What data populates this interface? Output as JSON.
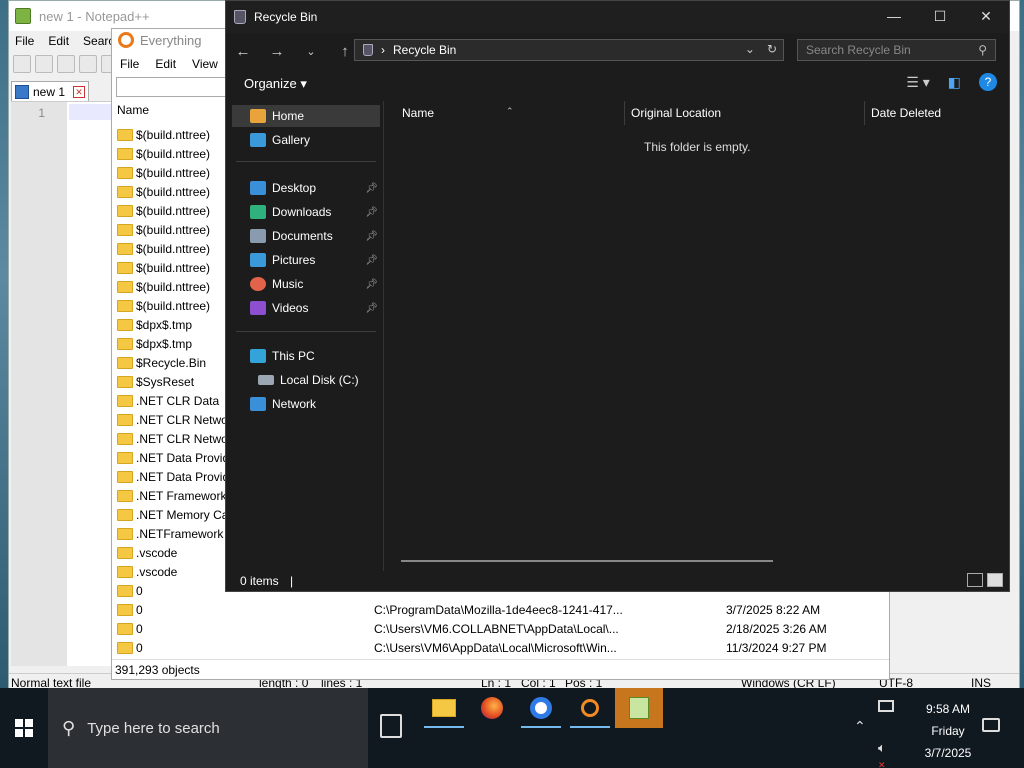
{
  "notepadpp": {
    "title": "new 1 - Notepad++",
    "menu": [
      "File",
      "Edit",
      "Search"
    ],
    "tab_label": "new 1",
    "line_number": "1",
    "status": {
      "type": "Normal text file",
      "length": "length : 0",
      "lines": "lines : 1",
      "ln": "Ln : 1",
      "col": "Col : 1",
      "pos": "Pos : 1",
      "eol": "Windows (CR LF)",
      "encoding": "UTF-8",
      "mode": "INS"
    }
  },
  "everything": {
    "title": "Everything",
    "menu": [
      "File",
      "Edit",
      "View"
    ],
    "column_name": "Name",
    "rows": [
      {
        "name": "$(build.nttree)",
        "location": "",
        "date": ""
      },
      {
        "name": "$(build.nttree)",
        "location": "",
        "date": ""
      },
      {
        "name": "$(build.nttree)",
        "location": "",
        "date": ""
      },
      {
        "name": "$(build.nttree)",
        "location": "",
        "date": ""
      },
      {
        "name": "$(build.nttree)",
        "location": "",
        "date": ""
      },
      {
        "name": "$(build.nttree)",
        "location": "",
        "date": ""
      },
      {
        "name": "$(build.nttree)",
        "location": "",
        "date": ""
      },
      {
        "name": "$(build.nttree)",
        "location": "",
        "date": ""
      },
      {
        "name": "$(build.nttree)",
        "location": "",
        "date": ""
      },
      {
        "name": "$(build.nttree)",
        "location": "",
        "date": ""
      },
      {
        "name": "$dpx$.tmp",
        "location": "",
        "date": ""
      },
      {
        "name": "$dpx$.tmp",
        "location": "",
        "date": ""
      },
      {
        "name": "$Recycle.Bin",
        "location": "",
        "date": ""
      },
      {
        "name": "$SysReset",
        "location": "",
        "date": ""
      },
      {
        "name": ".NET CLR Data",
        "location": "",
        "date": ""
      },
      {
        "name": ".NET CLR Networ",
        "location": "",
        "date": ""
      },
      {
        "name": ".NET CLR Networ",
        "location": "",
        "date": ""
      },
      {
        "name": ".NET Data Provid",
        "location": "",
        "date": ""
      },
      {
        "name": ".NET Data Provid",
        "location": "",
        "date": ""
      },
      {
        "name": ".NET Framework",
        "location": "",
        "date": ""
      },
      {
        "name": ".NET Memory Ca",
        "location": "",
        "date": ""
      },
      {
        "name": ".NETFramework",
        "location": "",
        "date": ""
      },
      {
        "name": ".vscode",
        "location": "",
        "date": ""
      },
      {
        "name": ".vscode",
        "location": "",
        "date": ""
      },
      {
        "name": "0",
        "location": "",
        "date": ""
      },
      {
        "name": "0",
        "location": "C:\\ProgramData\\Mozilla-1de4eec8-1241-417...",
        "date": "3/7/2025 8:22 AM"
      },
      {
        "name": "0",
        "location": "C:\\Users\\VM6.COLLABNET\\AppData\\Local\\...",
        "date": "2/18/2025 3:26 AM"
      },
      {
        "name": "0",
        "location": "C:\\Users\\VM6\\AppData\\Local\\Microsoft\\Win...",
        "date": "11/3/2024 9:27 PM"
      }
    ],
    "status": "391,293 objects"
  },
  "explorer": {
    "title": "Recycle Bin",
    "breadcrumb": "Recycle Bin",
    "search_placeholder": "Search Recycle Bin",
    "organize_label": "Organize",
    "nav": {
      "home": "Home",
      "gallery": "Gallery",
      "desktop": "Desktop",
      "downloads": "Downloads",
      "documents": "Documents",
      "pictures": "Pictures",
      "music": "Music",
      "videos": "Videos",
      "this_pc": "This PC",
      "local_disk": "Local Disk (C:)",
      "network": "Network"
    },
    "columns": {
      "name": "Name",
      "original_location": "Original Location",
      "date_deleted": "Date Deleted"
    },
    "empty_message": "This folder is empty.",
    "status": "0 items",
    "window_controls": {
      "minimize": "—",
      "maximize": "☐",
      "close": "✕"
    }
  },
  "taskbar": {
    "search_placeholder": "Type here to search",
    "clock_time": "9:58 AM",
    "clock_day": "Friday",
    "clock_date": "3/7/2025"
  },
  "colors": {
    "explorer_bg": "#1c1c1c",
    "accent": "#1e88e5",
    "taskbar_active": "#c8761d",
    "folder": "#f4c842"
  }
}
